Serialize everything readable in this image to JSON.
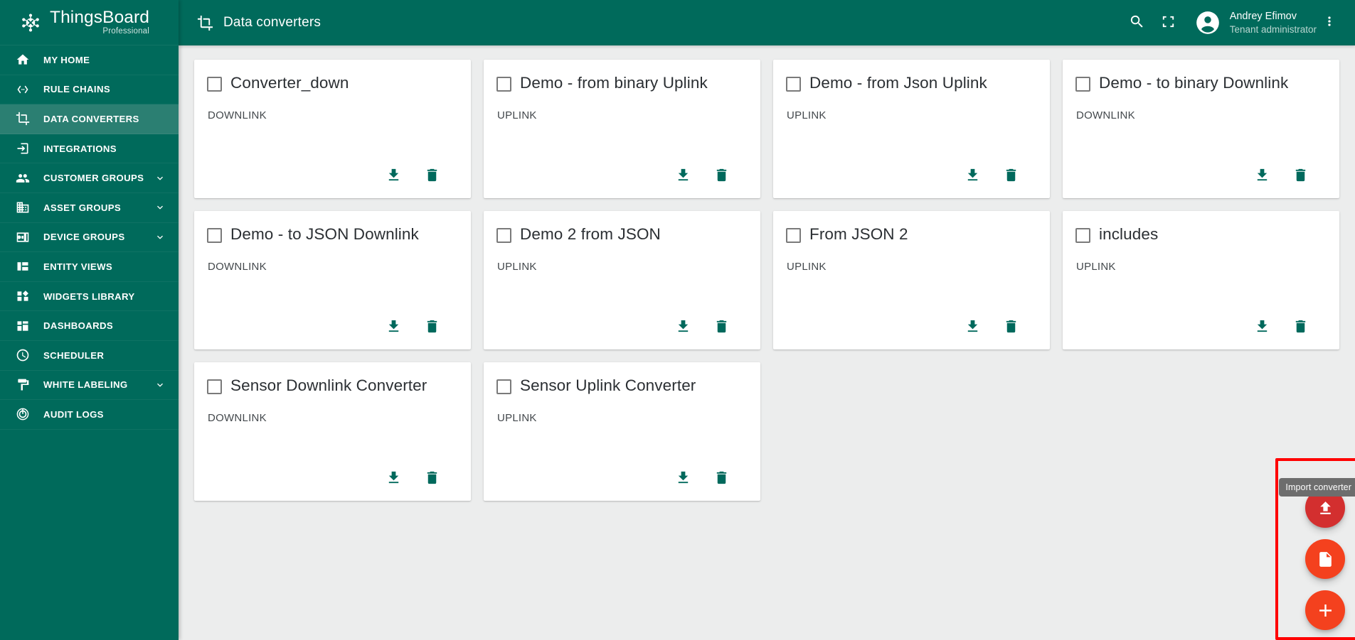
{
  "brand": {
    "title": "ThingsBoard",
    "subtitle": "Professional",
    "logo_icon": "thingsboard-logo-icon"
  },
  "sidebar": {
    "items": [
      {
        "label": "MY HOME",
        "icon": "home-icon",
        "active": false,
        "expandable": false
      },
      {
        "label": "RULE CHAINS",
        "icon": "rule-chains-icon",
        "active": false,
        "expandable": false
      },
      {
        "label": "DATA CONVERTERS",
        "icon": "data-converters-icon",
        "active": true,
        "expandable": false
      },
      {
        "label": "INTEGRATIONS",
        "icon": "integrations-icon",
        "active": false,
        "expandable": false
      },
      {
        "label": "CUSTOMER GROUPS",
        "icon": "customer-groups-icon",
        "active": false,
        "expandable": true
      },
      {
        "label": "ASSET GROUPS",
        "icon": "asset-groups-icon",
        "active": false,
        "expandable": true
      },
      {
        "label": "DEVICE GROUPS",
        "icon": "device-groups-icon",
        "active": false,
        "expandable": true
      },
      {
        "label": "ENTITY VIEWS",
        "icon": "entity-views-icon",
        "active": false,
        "expandable": false
      },
      {
        "label": "WIDGETS LIBRARY",
        "icon": "widgets-library-icon",
        "active": false,
        "expandable": false
      },
      {
        "label": "DASHBOARDS",
        "icon": "dashboards-icon",
        "active": false,
        "expandable": false
      },
      {
        "label": "SCHEDULER",
        "icon": "scheduler-icon",
        "active": false,
        "expandable": false
      },
      {
        "label": "WHITE LABELING",
        "icon": "white-labeling-icon",
        "active": false,
        "expandable": true
      },
      {
        "label": "AUDIT LOGS",
        "icon": "audit-logs-icon",
        "active": false,
        "expandable": false
      }
    ]
  },
  "topbar": {
    "title": "Data converters",
    "title_icon": "data-converters-icon",
    "search_icon": "search-icon",
    "fullscreen_icon": "fullscreen-icon",
    "avatar_icon": "account-circle-icon",
    "user_name": "Andrey Efimov",
    "user_role": "Tenant administrator",
    "more_icon": "more-vert-icon"
  },
  "colors": {
    "primary": "#006A5B",
    "sidebar_active": "#2b7f72",
    "accent_icon": "#00695c",
    "fab_import": "#d32f2f",
    "fab_create": "#f4411e",
    "fab_add": "#f4411e",
    "highlight": "#ff0000",
    "content_bg": "#eceded"
  },
  "converters": [
    {
      "name": "Converter_down",
      "type": "DOWNLINK"
    },
    {
      "name": "Demo - from binary Uplink",
      "type": "UPLINK"
    },
    {
      "name": "Demo - from Json Uplink",
      "type": "UPLINK"
    },
    {
      "name": "Demo - to binary Downlink",
      "type": "DOWNLINK"
    },
    {
      "name": "Demo - to JSON Downlink",
      "type": "DOWNLINK"
    },
    {
      "name": "Demo 2 from JSON",
      "type": "UPLINK"
    },
    {
      "name": "From JSON 2",
      "type": "UPLINK"
    },
    {
      "name": "includes",
      "type": "UPLINK"
    },
    {
      "name": "Sensor Downlink Converter",
      "type": "DOWNLINK"
    },
    {
      "name": "Sensor Uplink Converter",
      "type": "UPLINK"
    }
  ],
  "card_actions": {
    "export_icon": "download-icon",
    "delete_icon": "trash-icon"
  },
  "fabs": {
    "tooltip": "Import converter",
    "import_icon": "upload-icon",
    "create_icon": "file-icon",
    "add_icon": "plus-icon"
  }
}
